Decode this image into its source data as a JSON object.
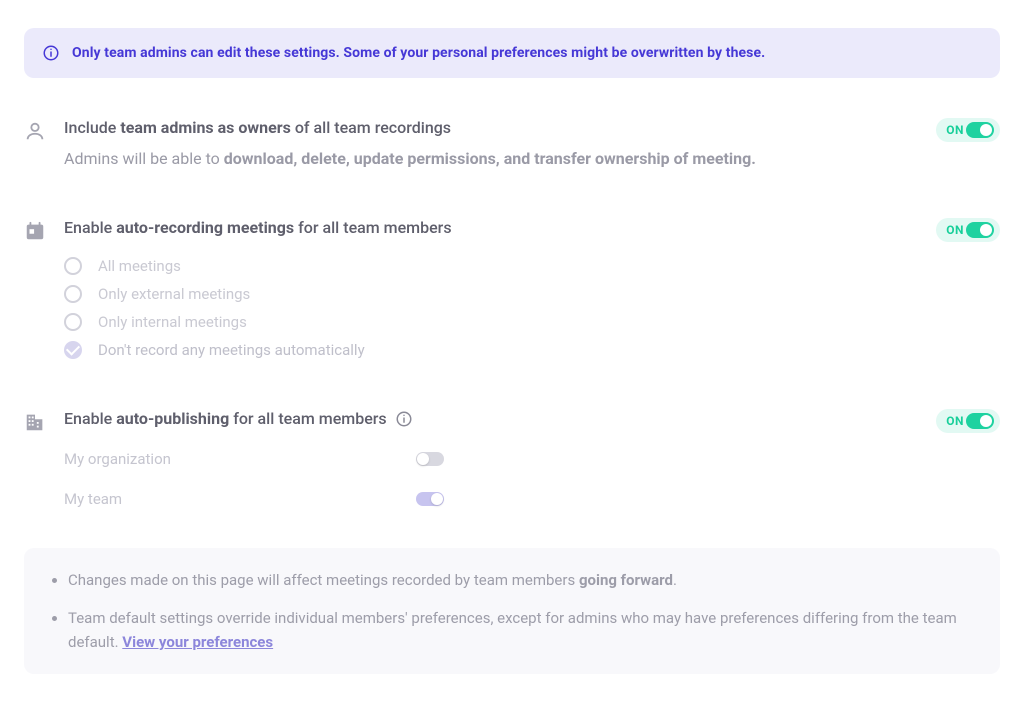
{
  "notice": {
    "text": "Only team admins can edit these settings. Some of your personal preferences might be overwritten by these."
  },
  "settings": {
    "include_admins": {
      "title_prefix": "Include ",
      "title_bold": "team admins as owners",
      "title_suffix": " of all team recordings",
      "desc_prefix": "Admins will be able to ",
      "desc_bold": "download, delete, update permissions, and transfer ownership of meeting.",
      "toggle_label": "ON",
      "toggle_state": "on"
    },
    "auto_recording": {
      "title_prefix": "Enable ",
      "title_bold": "auto-recording meetings",
      "title_suffix": " for all team members",
      "toggle_label": "ON",
      "toggle_state": "on",
      "options": [
        {
          "label": "All meetings",
          "selected": false
        },
        {
          "label": "Only external meetings",
          "selected": false
        },
        {
          "label": "Only internal meetings",
          "selected": false
        },
        {
          "label": "Don't record any meetings automatically",
          "selected": true
        }
      ]
    },
    "auto_publishing": {
      "title_prefix": "Enable ",
      "title_bold": "auto-publishing",
      "title_suffix": " for all team members",
      "toggle_label": "ON",
      "toggle_state": "on",
      "subs": [
        {
          "label": "My organization",
          "state": "off"
        },
        {
          "label": "My team",
          "state": "on"
        }
      ]
    }
  },
  "footer": {
    "bullets": [
      {
        "prefix": "Changes made on this page will affect meetings recorded by team members ",
        "bold": "going forward",
        "suffix": "."
      },
      {
        "prefix": "Team default settings override individual members' preferences, except for admins who may have preferences differing from the team default. ",
        "link": "View your preferences"
      }
    ]
  }
}
